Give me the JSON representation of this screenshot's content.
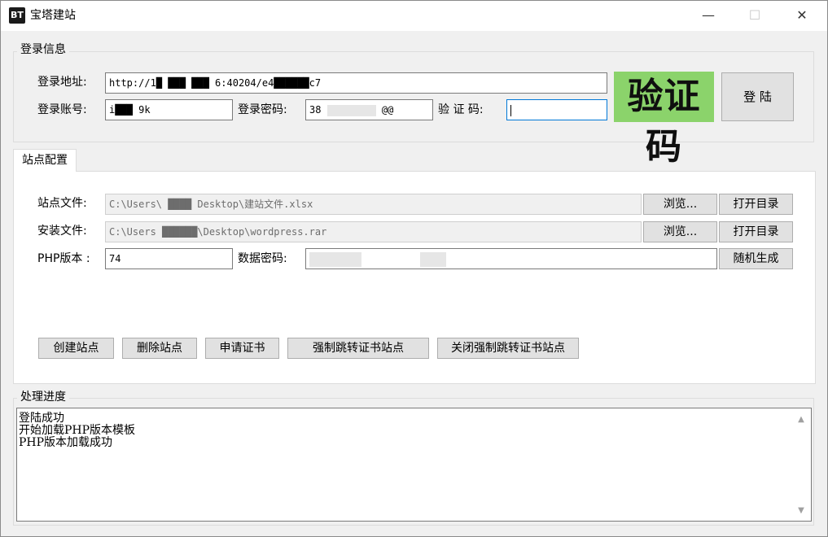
{
  "window": {
    "icon_text": "BT",
    "title": "宝塔建站",
    "minimize": "—",
    "maximize": "☐",
    "close": "✕"
  },
  "login": {
    "group_title": "登录信息",
    "address_label": "登录地址:",
    "address_value": "http://1█  ███ ███ 6:40204/e4██████c7",
    "account_label": "登录账号:",
    "account_value": "i███ 9k",
    "password_label": "登录密码:",
    "password_value": "38",
    "password_tail": "@@",
    "captcha_label": "验 证 码:",
    "captcha_value": "",
    "captcha_image_text": "验证码",
    "login_button": "登 陆"
  },
  "site_config": {
    "tab_label": "站点配置",
    "site_file_label": "站点文件:",
    "site_file_value": "C:\\Users\\ ████ Desktop\\建站文件.xlsx",
    "install_file_label": "安装文件:",
    "install_file_value": "C:\\Users ██████\\Desktop\\wordpress.rar",
    "php_label": "PHP版本 :",
    "php_value": "74",
    "db_password_label": "数据密码:",
    "db_password_value": "",
    "browse_button": "浏览...",
    "open_dir_button": "打开目录",
    "random_button": "随机生成",
    "actions": [
      "创建站点",
      "删除站点",
      "申请证书",
      "强制跳转证书站点",
      "关闭强制跳转证书站点"
    ]
  },
  "progress": {
    "group_title": "处理进度",
    "log_lines": [
      "登陆成功",
      "开始加载PHP版本模板",
      "PHP版本加载成功"
    ],
    "scroll_up": "▲",
    "scroll_down": "▼"
  },
  "colors": {
    "captcha_bg": "#8bd36b",
    "focus_border": "#0078d7",
    "window_bg": "#f0f0f0"
  }
}
